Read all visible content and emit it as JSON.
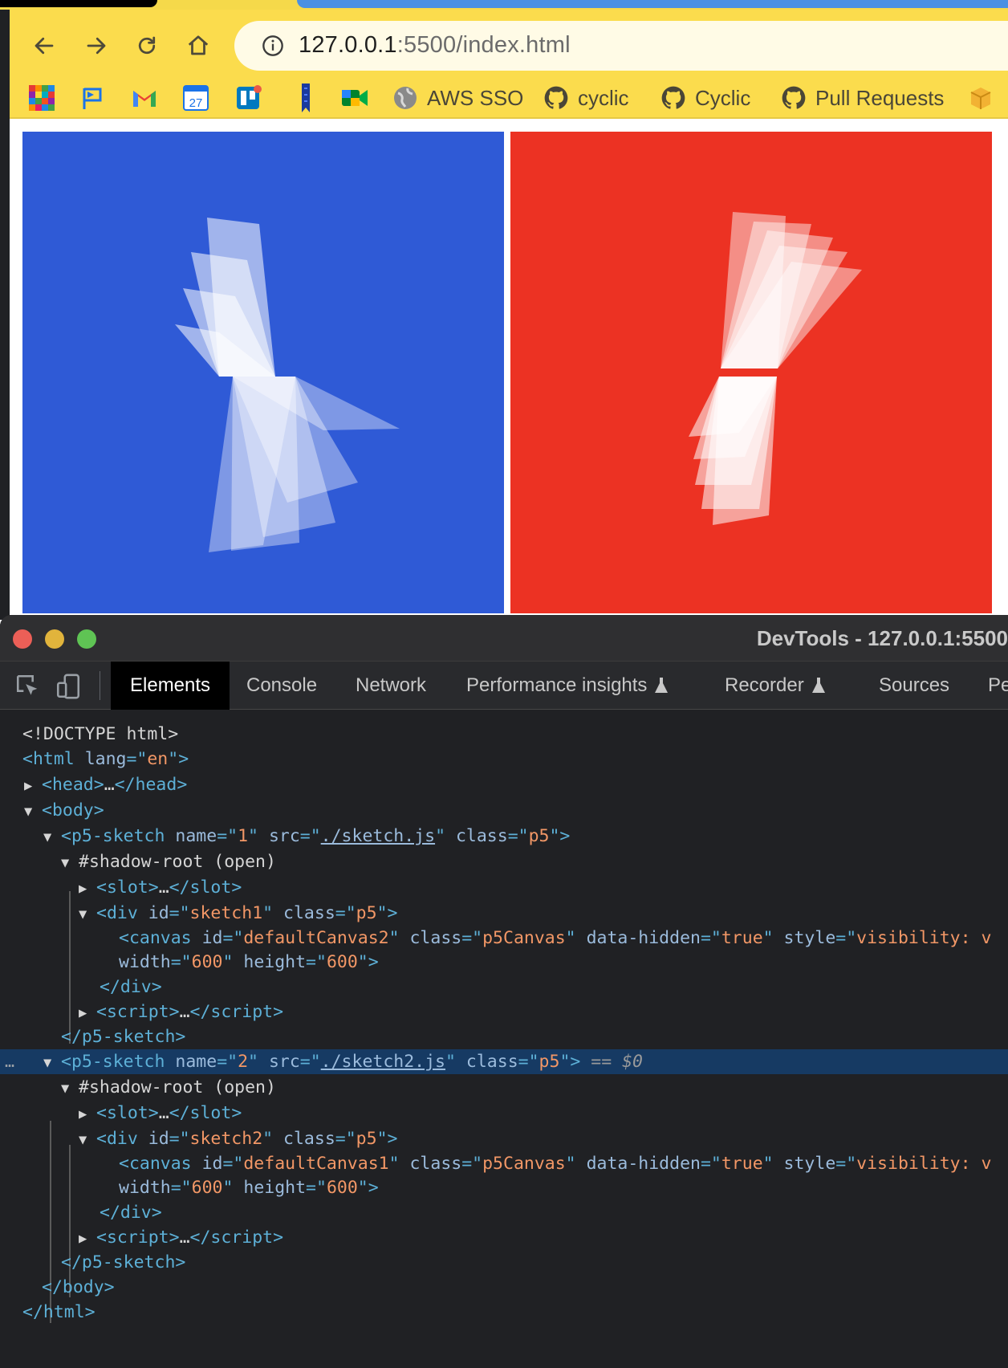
{
  "browser": {
    "url_host": "127.0.0.1",
    "url_rest": ":5500/index.html",
    "bookmarks": [
      {
        "icon": "apps-grid-icon",
        "label": ""
      },
      {
        "icon": "flag-icon",
        "label": ""
      },
      {
        "icon": "gmail-icon",
        "label": ""
      },
      {
        "icon": "calendar-icon",
        "label": "",
        "day": "27"
      },
      {
        "icon": "trello-icon",
        "label": ""
      },
      {
        "icon": "bookmark-icon",
        "label": ""
      },
      {
        "icon": "meet-icon",
        "label": ""
      },
      {
        "icon": "globe-icon",
        "label": "AWS SSO"
      },
      {
        "icon": "github-icon",
        "label": "cyclic"
      },
      {
        "icon": "github-icon",
        "label": "Cyclic"
      },
      {
        "icon": "github-icon",
        "label": "Pull Requests"
      },
      {
        "icon": "box-icon",
        "label": ""
      }
    ]
  },
  "page": {
    "sketch1": {
      "background": "#2f5ad6",
      "shape": "#ffffff"
    },
    "sketch2": {
      "background": "#ec3223",
      "shape": "#ffffff"
    }
  },
  "devtools": {
    "title": "DevTools - 127.0.0.1:5500",
    "tabs": [
      {
        "label": "Elements",
        "active": true
      },
      {
        "label": "Console",
        "active": false
      },
      {
        "label": "Network",
        "active": false
      },
      {
        "label": "Performance insights",
        "active": false,
        "experimental": true
      },
      {
        "label": "Recorder",
        "active": false,
        "experimental": true
      },
      {
        "label": "Sources",
        "active": false
      },
      {
        "label": "Pe",
        "active": false
      }
    ],
    "dom": {
      "doctype": "<!DOCTYPE html>",
      "html_open": "html",
      "lang_attr": "lang",
      "lang_val": "en",
      "head": "head",
      "body": "body",
      "p5_tag": "p5-sketch",
      "name_attr": "name",
      "src_attr": "src",
      "class_attr": "class",
      "id_attr": "id",
      "p5_class": "p5",
      "sketch1_name": "1",
      "sketch1_src": "./sketch.js",
      "sketch2_name": "2",
      "sketch2_src": "./sketch2.js",
      "shadow_root": "#shadow-root (open)",
      "slot": "slot",
      "div": "div",
      "div1_id": "sketch1",
      "div2_id": "sketch2",
      "canvas": "canvas",
      "canvas1_id": "defaultCanvas2",
      "canvas2_id": "defaultCanvas1",
      "canvas_class": "p5Canvas",
      "data_hidden_attr": "data-hidden",
      "data_hidden_val": "true",
      "style_attr": "style",
      "style_val": "visibility: v",
      "width_attr": "width",
      "width_val": "600",
      "height_attr": "height",
      "height_val": "600",
      "script": "script",
      "ellipsis": "…",
      "selected_marker": "== $0",
      "dots": "…"
    }
  }
}
